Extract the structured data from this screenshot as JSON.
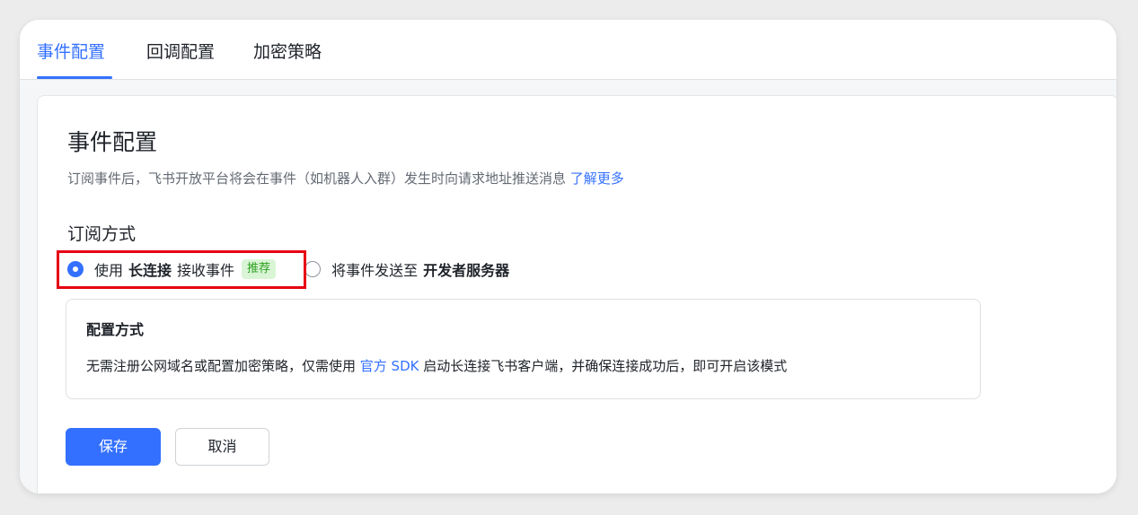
{
  "tabs": [
    {
      "label": "事件配置",
      "active": true
    },
    {
      "label": "回调配置",
      "active": false
    },
    {
      "label": "加密策略",
      "active": false
    }
  ],
  "card": {
    "title": "事件配置",
    "description": "订阅事件后，飞书开放平台将会在事件（如机器人入群）发生时向请求地址推送消息 ",
    "learn_more": "了解更多",
    "subscription_label": "订阅方式",
    "options": [
      {
        "prefix": "使用",
        "bold": "长连接",
        "suffix": "接收事件",
        "tag": "推荐",
        "checked": true
      },
      {
        "prefix": "将事件发送至",
        "bold": "开发者服务器",
        "suffix": "",
        "checked": false
      }
    ],
    "info": {
      "title": "配置方式",
      "text_before": "无需注册公网域名或配置加密策略，仅需使用 ",
      "link": "官方 SDK",
      "text_after": " 启动长连接飞书客户端，并确保连接成功后，即可开启该模式"
    },
    "save_label": "保存",
    "cancel_label": "取消"
  },
  "colors": {
    "accent": "#3370ff",
    "tag_text": "#2ea121",
    "tag_bg": "#d9f5d6",
    "highlight": "#e60012"
  }
}
